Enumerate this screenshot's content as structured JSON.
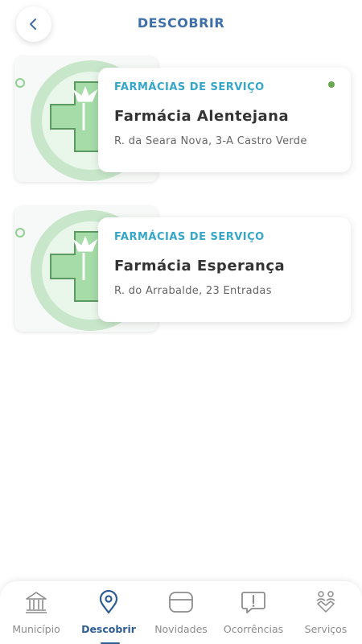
{
  "header": {
    "title": "DESCOBRIR"
  },
  "cards": [
    {
      "category": "FARMÁCIAS DE SERVIÇO",
      "name": "Farmácia Alentejana",
      "address": "R. da Seara Nova, 3-A Castro Verde",
      "status_color": "#6aa84f"
    },
    {
      "category": "FARMÁCIAS DE SERVIÇO",
      "name": "Farmácia Esperança",
      "address": "R. do Arrabalde, 23 Entradas"
    }
  ],
  "nav": {
    "items": [
      {
        "label": "Município",
        "icon": "municipality-icon"
      },
      {
        "label": "Descobrir",
        "icon": "location-pin-icon",
        "active": true
      },
      {
        "label": "Novidades",
        "icon": "news-icon"
      },
      {
        "label": "Ocorrências",
        "icon": "alert-icon"
      },
      {
        "label": "Serviços",
        "icon": "services-icon"
      }
    ]
  },
  "colors": {
    "accent": "#3f6fa8",
    "category": "#36a6c9",
    "active_nav": "#2f5d91",
    "inactive_nav": "#8c8c8c"
  }
}
